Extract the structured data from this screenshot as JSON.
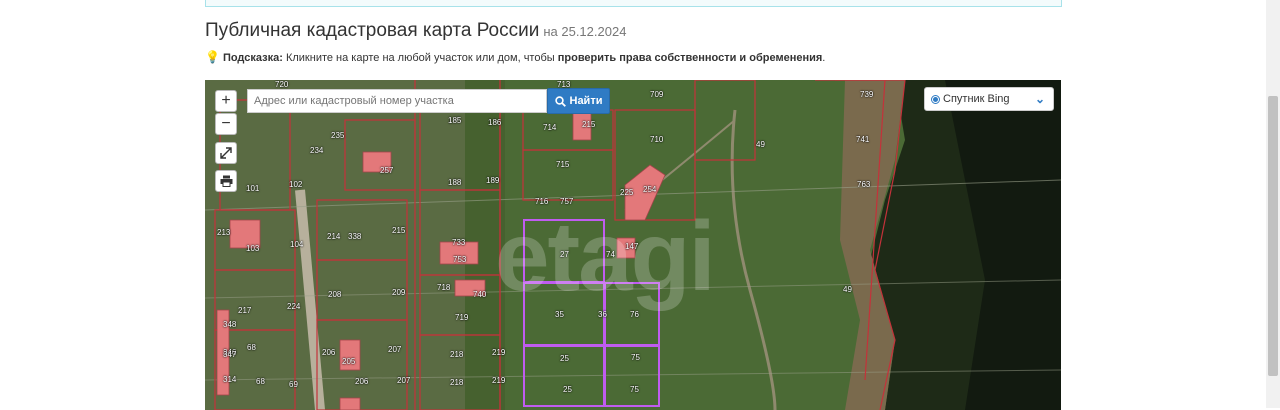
{
  "header": {
    "title": "Публичная кадастровая карта России",
    "date": "на 25.12.2024"
  },
  "hint": {
    "label": "Подсказка:",
    "text": " Кликните на карте на любой участок или дом, чтобы ",
    "bold_text": "проверить права собственности и обременения",
    "end": "."
  },
  "map": {
    "zoom_in": "+",
    "zoom_out": "−",
    "fullscreen_icon": "expand-icon",
    "print_icon": "printer-icon",
    "search": {
      "placeholder": "Адрес или кадастровый номер участка",
      "button_label": "Найти"
    },
    "layer_select": {
      "selected": "Спутник Bing"
    },
    "watermark": "etagi",
    "parcel_labels": [
      "720",
      "713",
      "709",
      "739",
      "185",
      "186",
      "714",
      "215",
      "710",
      "235",
      "234",
      "257",
      "49",
      "741",
      "101",
      "102",
      "188",
      "189",
      "715",
      "225",
      "254",
      "763",
      "716",
      "757",
      "214",
      "338",
      "215",
      "733",
      "753",
      "27",
      "74",
      "147",
      "104",
      "103",
      "213",
      "49",
      "718",
      "740",
      "208",
      "209",
      "217",
      "224",
      "719",
      "35",
      "36",
      "76",
      "207",
      "206",
      "68",
      "205",
      "218",
      "219",
      "25",
      "75",
      "206",
      "207",
      "218",
      "219",
      "25",
      "75",
      "68",
      "348",
      "314",
      "346",
      "347",
      "69"
    ]
  },
  "colors": {
    "accent": "#2f7bc4",
    "parcel_border": "#c4323a",
    "selected_parcel": "#c05cf0",
    "building": "#e3787a"
  }
}
